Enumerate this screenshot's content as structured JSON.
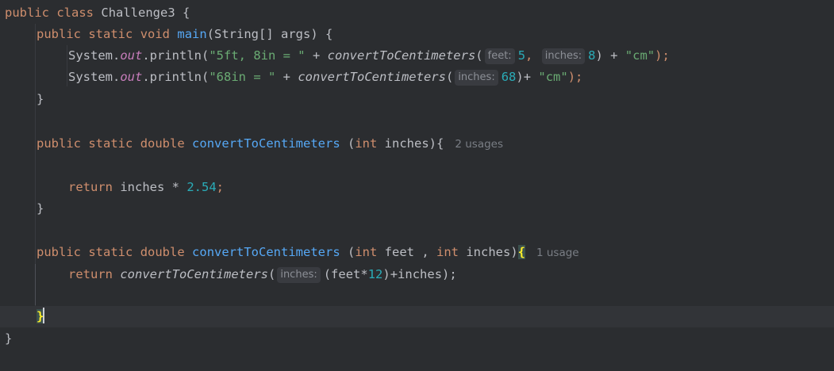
{
  "editor": {
    "language": "java",
    "class_decl": {
      "kw1": "public",
      "kw2": "class",
      "name": "Challenge3",
      "brace": " {"
    },
    "main_decl": {
      "kw1": "public",
      "kw2": "static",
      "kw3": "void",
      "name": "main",
      "params": "(String[] args) {"
    },
    "line3": {
      "obj": "System.",
      "field": "out",
      "call": ".println(",
      "str1": "\"5ft, 8in = \"",
      "plus": " + ",
      "method": "convertToCentimeters",
      "open": "(",
      "hint_feet": "feet:",
      "num1": "5",
      "comma": ", ",
      "hint_inches": "inches:",
      "num2": "8",
      "close": ") + ",
      "str2": "\"cm\"",
      "end": ");"
    },
    "line4": {
      "obj": "System.",
      "field": "out",
      "call": ".println(",
      "str1": "\"68in = \"",
      "plus": " + ",
      "method": "convertToCentimeters",
      "open": "(",
      "hint_inches": "inches:",
      "num": "68",
      "close": ")+ ",
      "str2": "\"cm\"",
      "end": ");"
    },
    "close_brace": "}",
    "method1_decl": {
      "kw1": "public",
      "kw2": "static",
      "kw3": "double",
      "name": "convertToCentimeters",
      "open": " (",
      "type": "int",
      "rest": " inches){",
      "usages": "2 usages"
    },
    "return1": {
      "kw": "return",
      "rest": " inches * ",
      "num": "2.54",
      "end": ";"
    },
    "method2_decl": {
      "kw1": "public",
      "kw2": "static",
      "kw3": "double",
      "name": "convertToCentimeters",
      "open": " (",
      "type1": "int",
      "mid": " feet , ",
      "type2": "int",
      "rest": " inches)",
      "brace": "{",
      "usages": "1 usage"
    },
    "return2": {
      "kw": "return",
      "method": "convertToCentimeters",
      "open": "(",
      "hint_inches": "inches:",
      "rest": "(feet*",
      "num": "12",
      "end": ")+inches);"
    },
    "colors": {
      "background": "#2b2d30",
      "keyword": "#cf8e6d",
      "declaration": "#56a8f5",
      "string": "#6aab73",
      "number": "#2aacb8",
      "static_field": "#c77dbb",
      "text": "#bcbec4",
      "brace_match": "#ffef28"
    }
  }
}
